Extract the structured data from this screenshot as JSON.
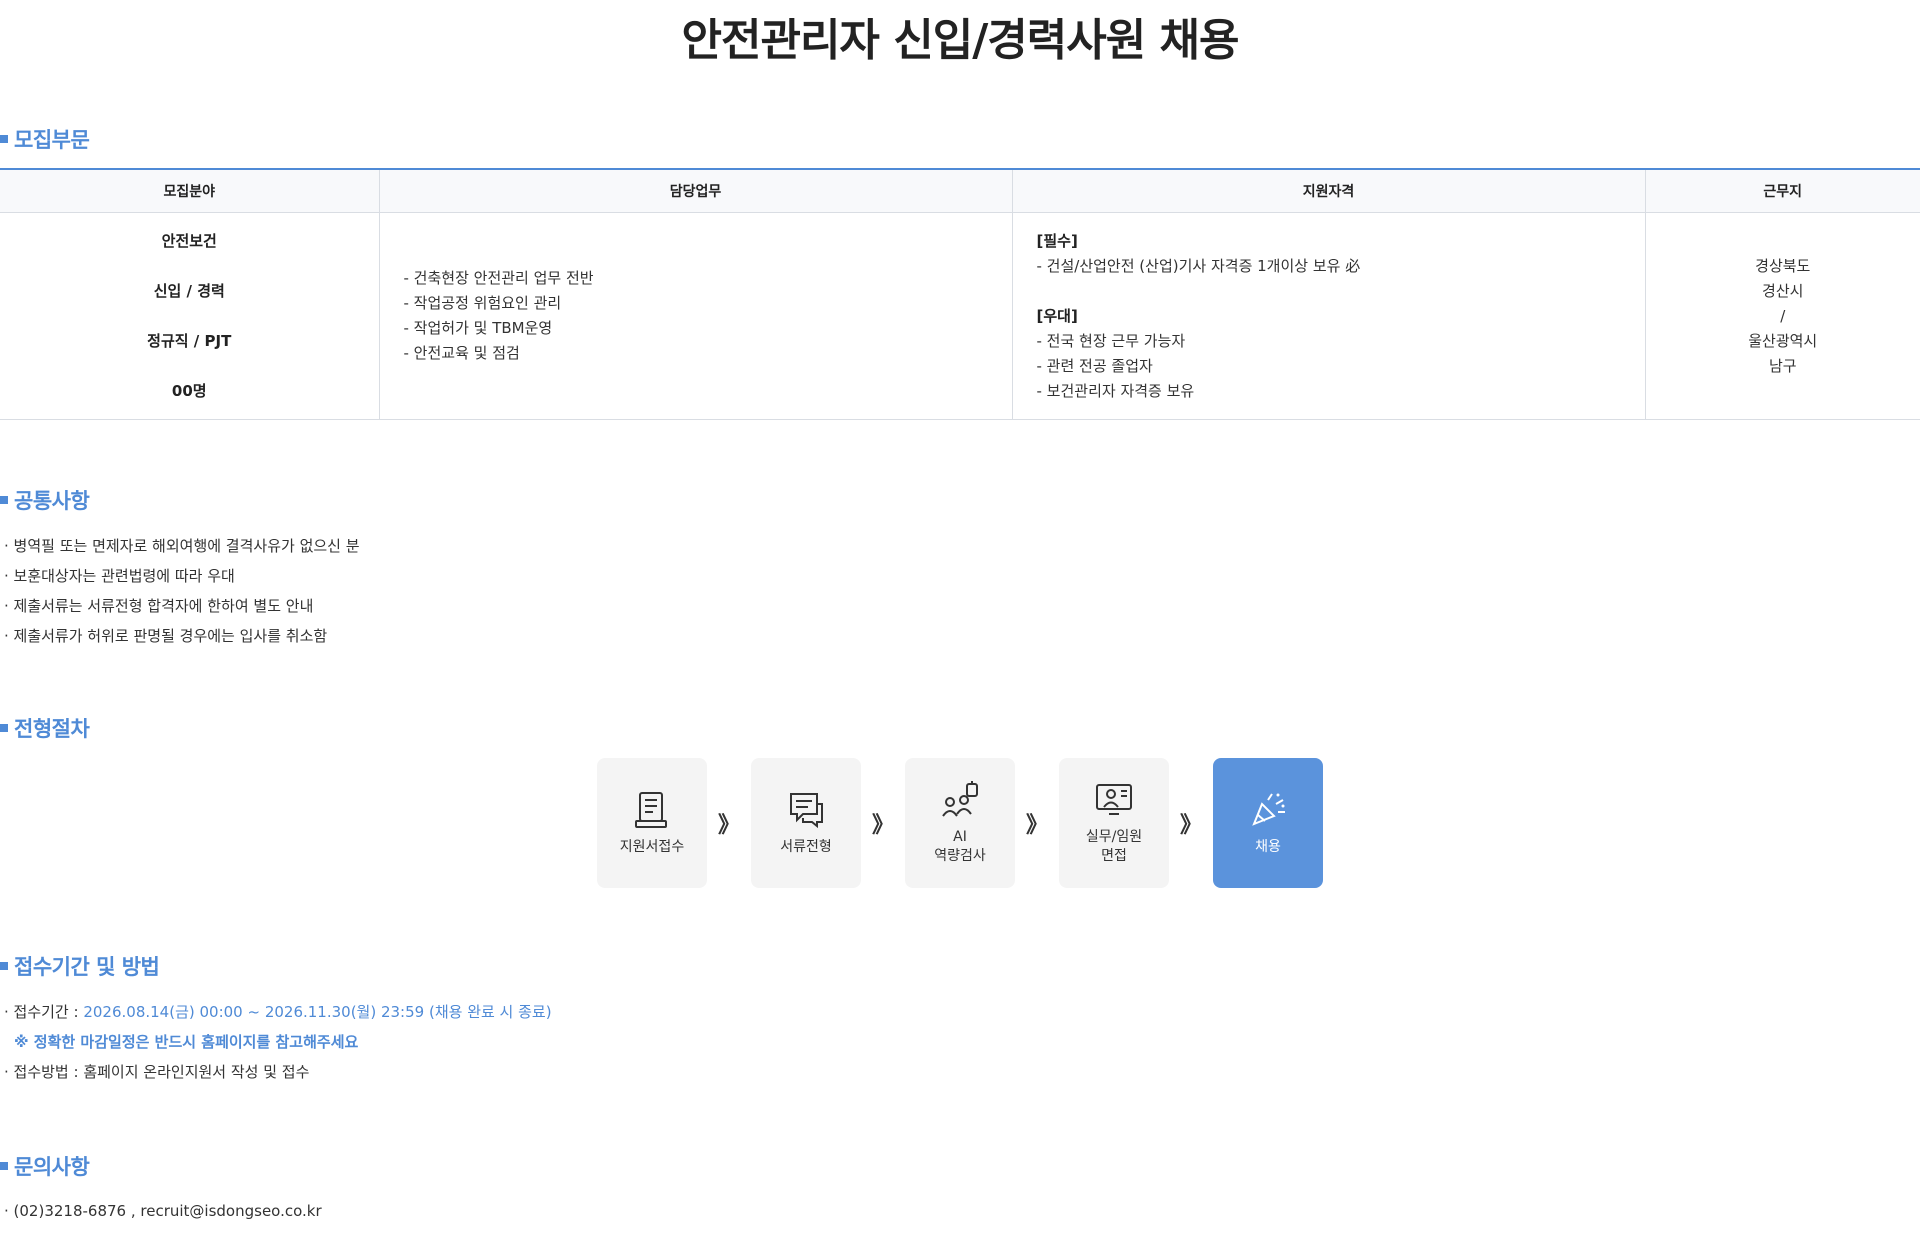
{
  "title": "안전관리자 신입/경력사원 채용",
  "sections": {
    "recruit": "모집부문",
    "common": "공통사항",
    "process": "전형절차",
    "apply": "접수기간 및 방법",
    "contact": "문의사항"
  },
  "table": {
    "headers": [
      "모집분야",
      "담당업무",
      "지원자격",
      "근무지"
    ],
    "field": [
      "안전보건",
      "신입 / 경력",
      "정규직 / PJT",
      "00명"
    ],
    "duties": [
      "- 건축현장 안전관리 업무 전반",
      "- 작업공정 위험요인 관리",
      "- 작업허가 및 TBM운영",
      "- 안전교육 및 점검"
    ],
    "required_label": "[필수]",
    "required": [
      "- 건설/산업안전 (산업)기사 자격증 1개이상 보유 必"
    ],
    "preferred_label": "[우대]",
    "preferred": [
      "- 전국 현장 근무 가능자",
      "- 관련 전공 졸업자",
      "- 보건관리자 자격증 보유"
    ],
    "location": [
      "경상북도",
      "경산시",
      "/",
      "울산광역시",
      "남구"
    ]
  },
  "common_items": [
    "· 병역필 또는 면제자로 해외여행에 결격사유가 없으신 분",
    "· 보훈대상자는 관련법령에 따라 우대",
    "· 제출서류는 서류전형 합격자에 한하여 별도 안내",
    "· 제출서류가 허위로 판명될 경우에는 입사를 취소함"
  ],
  "process_steps": [
    {
      "line1": "지원서접수",
      "line2": "",
      "icon": "document-icon"
    },
    {
      "line1": "서류전형",
      "line2": "",
      "icon": "chat-icon"
    },
    {
      "line1": "AI",
      "line2": "역량검사",
      "icon": "ai-people-icon"
    },
    {
      "line1": "실무/임원",
      "line2": "면접",
      "icon": "monitor-interview-icon"
    },
    {
      "line1": "채용",
      "line2": "",
      "icon": "party-popper-icon"
    }
  ],
  "process_arrow": "》",
  "apply_info": {
    "period_label": "· 접수기간 : ",
    "period_value": "2026.08.14(금) 00:00 ~ 2026.11.30(월) 23:59 (채용 완료 시 종료)",
    "note": "※ 정확한 마감일정은 반드시 홈페이지를 참고해주세요",
    "method": "· 접수방법 : 홈페이지 온라인지원서 작성 및 접수"
  },
  "contact_info": "· (02)3218-6876 , recruit@isdongseo.co.kr",
  "colors": {
    "accent": "#4f8ad6",
    "active_step": "#5b93dc",
    "step_bg": "#f4f4f4"
  }
}
